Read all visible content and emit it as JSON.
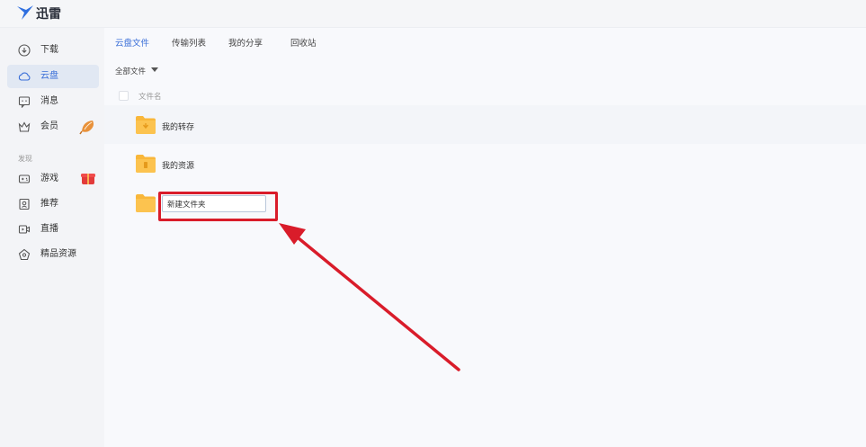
{
  "app": {
    "title": "迅雷",
    "accent": "#3a6fd8"
  },
  "sidebar": {
    "items": [
      {
        "label": "下载",
        "icon": "download-icon"
      },
      {
        "label": "云盘",
        "icon": "cloud-icon",
        "active": true
      },
      {
        "label": "消息",
        "icon": "message-icon"
      },
      {
        "label": "会员",
        "icon": "crown-icon",
        "badge": "shell-badge-icon"
      }
    ],
    "discover_label": "发现",
    "discover_items": [
      {
        "label": "游戏",
        "icon": "gamepad-icon",
        "badge": "gift-badge-icon"
      },
      {
        "label": "推荐",
        "icon": "recommend-icon"
      },
      {
        "label": "直播",
        "icon": "live-icon"
      },
      {
        "label": "精品资源",
        "icon": "gem-icon"
      }
    ]
  },
  "tabs": [
    {
      "label": "云盘文件",
      "active": true
    },
    {
      "label": "传输列表"
    },
    {
      "label": "我的分享"
    },
    {
      "label": "回收站"
    }
  ],
  "filter": {
    "label": "全部文件"
  },
  "file_list": {
    "header_name": "文件名",
    "rows": [
      {
        "name": "我的转存",
        "icon": "folder-transfer-icon"
      },
      {
        "name": "我的资源",
        "icon": "folder-resource-icon"
      }
    ],
    "new_folder": {
      "value": "新建文件夹",
      "icon": "folder-icon"
    }
  },
  "annotation": {
    "color": "#d91c2a"
  }
}
